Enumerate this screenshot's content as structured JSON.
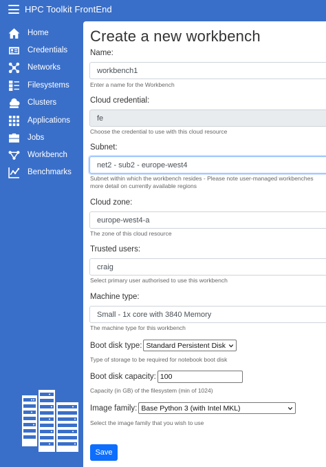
{
  "app": {
    "title": "HPC Toolkit FrontEnd"
  },
  "sidebar": {
    "items": [
      {
        "label": "Home",
        "icon": "home-icon"
      },
      {
        "label": "Credentials",
        "icon": "id-card-icon"
      },
      {
        "label": "Networks",
        "icon": "network-icon"
      },
      {
        "label": "Filesystems",
        "icon": "filesystem-icon"
      },
      {
        "label": "Clusters",
        "icon": "cluster-icon"
      },
      {
        "label": "Applications",
        "icon": "grid-icon"
      },
      {
        "label": "Jobs",
        "icon": "briefcase-icon"
      },
      {
        "label": "Workbench",
        "icon": "workbench-icon"
      },
      {
        "label": "Benchmarks",
        "icon": "chart-icon"
      }
    ]
  },
  "form": {
    "title": "Create a new workbench",
    "name": {
      "label": "Name:",
      "value": "workbench1",
      "help": "Enter a name for the Workbench"
    },
    "credential": {
      "label": "Cloud credential:",
      "value": "fe",
      "help": "Choose the credential to use with this cloud resource"
    },
    "subnet": {
      "label": "Subnet:",
      "value": "net2 - sub2 - europe-west4",
      "help_line1": "Subnet within which the workbench resides - Please note user-managed workbenches",
      "help_line2": "more detail on currently available regions"
    },
    "zone": {
      "label": "Cloud zone:",
      "value": "europe-west4-a",
      "help": "The zone of this cloud resource"
    },
    "trusted_users": {
      "label": "Trusted users:",
      "value": "craig",
      "help": "Select primary user authorised to use this workbench"
    },
    "machine_type": {
      "label": "Machine type:",
      "value": "Small - 1x core with 3840 Memory",
      "help": "The machine type for this workbench"
    },
    "boot_disk_type": {
      "label": "Boot disk type:",
      "value": "Standard Persistent Disk",
      "help": "Type of storage to be required for notebook boot disk"
    },
    "boot_disk_capacity": {
      "label": "Boot disk capacity:",
      "value": "100",
      "help": "Capacity (in GB) of the filesystem (min of 1024)"
    },
    "image_family": {
      "label": "Image family:",
      "value": "Base Python 3 (with Intel MKL)",
      "help": "Select the image family that you wish to use"
    },
    "save_label": "Save"
  },
  "colors": {
    "brand": "#3a6fc9",
    "primary_button": "#0d6efd"
  }
}
